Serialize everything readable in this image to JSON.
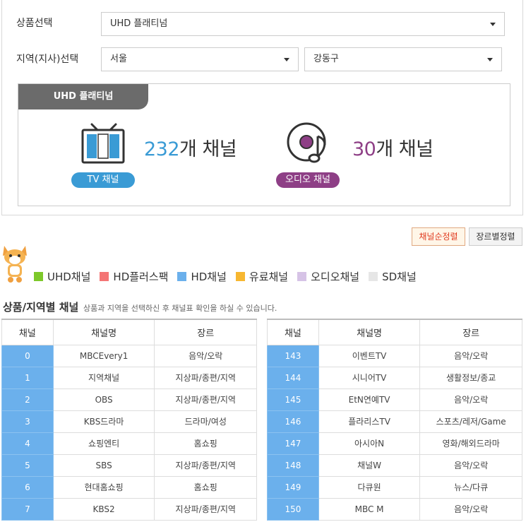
{
  "filters": {
    "product_label": "상품선택",
    "product_value": "UHD 플래티넘",
    "region_label": "지역(지사)선택",
    "region_value": "서울",
    "district_value": "강동구"
  },
  "summary": {
    "tab_label": "UHD 플래티넘",
    "tv": {
      "count": "232",
      "unit": "개 채널",
      "label": "TV 채널"
    },
    "audio": {
      "count": "30",
      "unit": "개 채널",
      "label": "오디오 채널"
    }
  },
  "sort": {
    "by_channel": "채널순정렬",
    "by_genre": "장르별정렬"
  },
  "legend": [
    {
      "label": "UHD채널",
      "color": "#7dc82a"
    },
    {
      "label": "HD플러스팩",
      "color": "#f47575"
    },
    {
      "label": "HD채널",
      "color": "#6bb0ec"
    },
    {
      "label": "유료채널",
      "color": "#f7b731"
    },
    {
      "label": "오디오채널",
      "color": "#d6c3e6"
    },
    {
      "label": "SD채널",
      "color": "#e6e6e6"
    }
  ],
  "section": {
    "title": "상품/지역별 채널",
    "subtitle": "상품과 지역을 선택하신 후 채널표 확인을 하실 수 있습니다."
  },
  "table_headers": {
    "num": "채널",
    "name": "채널명",
    "genre": "장르"
  },
  "left_table": [
    {
      "num": "0",
      "name": "MBCEvery1",
      "genre": "음악/오락"
    },
    {
      "num": "1",
      "name": "지역채널",
      "genre": "지상파/종편/지역"
    },
    {
      "num": "2",
      "name": "OBS",
      "genre": "지상파/종편/지역"
    },
    {
      "num": "3",
      "name": "KBS드라마",
      "genre": "드라마/여성"
    },
    {
      "num": "4",
      "name": "쇼핑엔티",
      "genre": "홈쇼핑"
    },
    {
      "num": "5",
      "name": "SBS",
      "genre": "지상파/종편/지역"
    },
    {
      "num": "6",
      "name": "현대홈쇼핑",
      "genre": "홈쇼핑"
    },
    {
      "num": "7",
      "name": "KBS2",
      "genre": "지상파/종편/지역"
    }
  ],
  "right_table": [
    {
      "num": "143",
      "name": "이벤트TV",
      "genre": "음악/오락"
    },
    {
      "num": "144",
      "name": "시니어TV",
      "genre": "생활정보/종교"
    },
    {
      "num": "145",
      "name": "EtN연예TV",
      "genre": "음악/오락"
    },
    {
      "num": "146",
      "name": "플라리스TV",
      "genre": "스포츠/레저/Game"
    },
    {
      "num": "147",
      "name": "아시아N",
      "genre": "영화/해외드라마"
    },
    {
      "num": "148",
      "name": "채널W",
      "genre": "음악/오락"
    },
    {
      "num": "149",
      "name": "다큐원",
      "genre": "뉴스/다큐"
    },
    {
      "num": "150",
      "name": "MBC M",
      "genre": "음악/오락"
    }
  ]
}
